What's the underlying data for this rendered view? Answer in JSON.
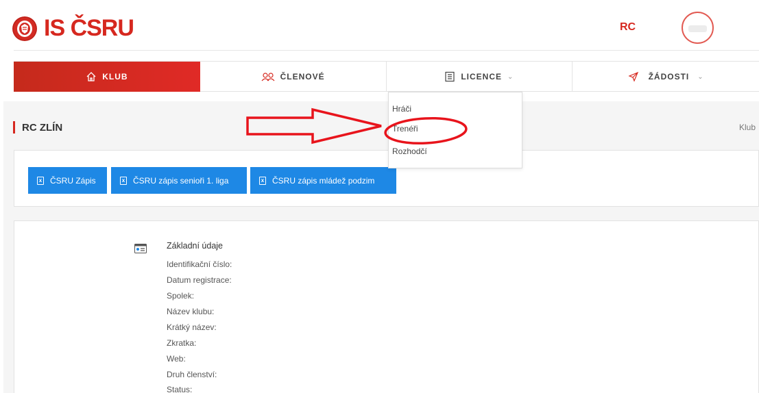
{
  "header": {
    "logo_text": "IS ČSRU",
    "user_initials": "RC"
  },
  "nav": {
    "items": [
      {
        "label": "KLUB",
        "icon": "home-icon",
        "active": true
      },
      {
        "label": "ČLENOVÉ",
        "icon": "members-icon",
        "active": false
      },
      {
        "label": "LICENCE",
        "icon": "document-icon",
        "active": false,
        "has_dropdown": true
      },
      {
        "label": "ŽÁDOSTI",
        "icon": "send-icon",
        "active": false,
        "has_dropdown": true
      }
    ]
  },
  "dropdown": {
    "items": [
      "Hráči",
      "Trenéři",
      "Rozhodčí"
    ]
  },
  "page": {
    "title": "RC ZLÍN",
    "breadcrumb": "Klub"
  },
  "buttons": [
    "ČSRU Zápis",
    "ČSRU zápis senioři 1. liga",
    "ČSRU zápis mládež podzim"
  ],
  "info": {
    "section_title": "Základní údaje",
    "fields": [
      "Identifikační číslo:",
      "Datum registrace:",
      "Spolek:",
      "Název klubu:",
      "Krátký název:",
      "Zkratka:",
      "Web:",
      "Druh členství:",
      "Status:"
    ]
  },
  "colors": {
    "brand_red": "#d6281f",
    "button_blue": "#1e88e5",
    "annotation_red": "#e8141c"
  }
}
